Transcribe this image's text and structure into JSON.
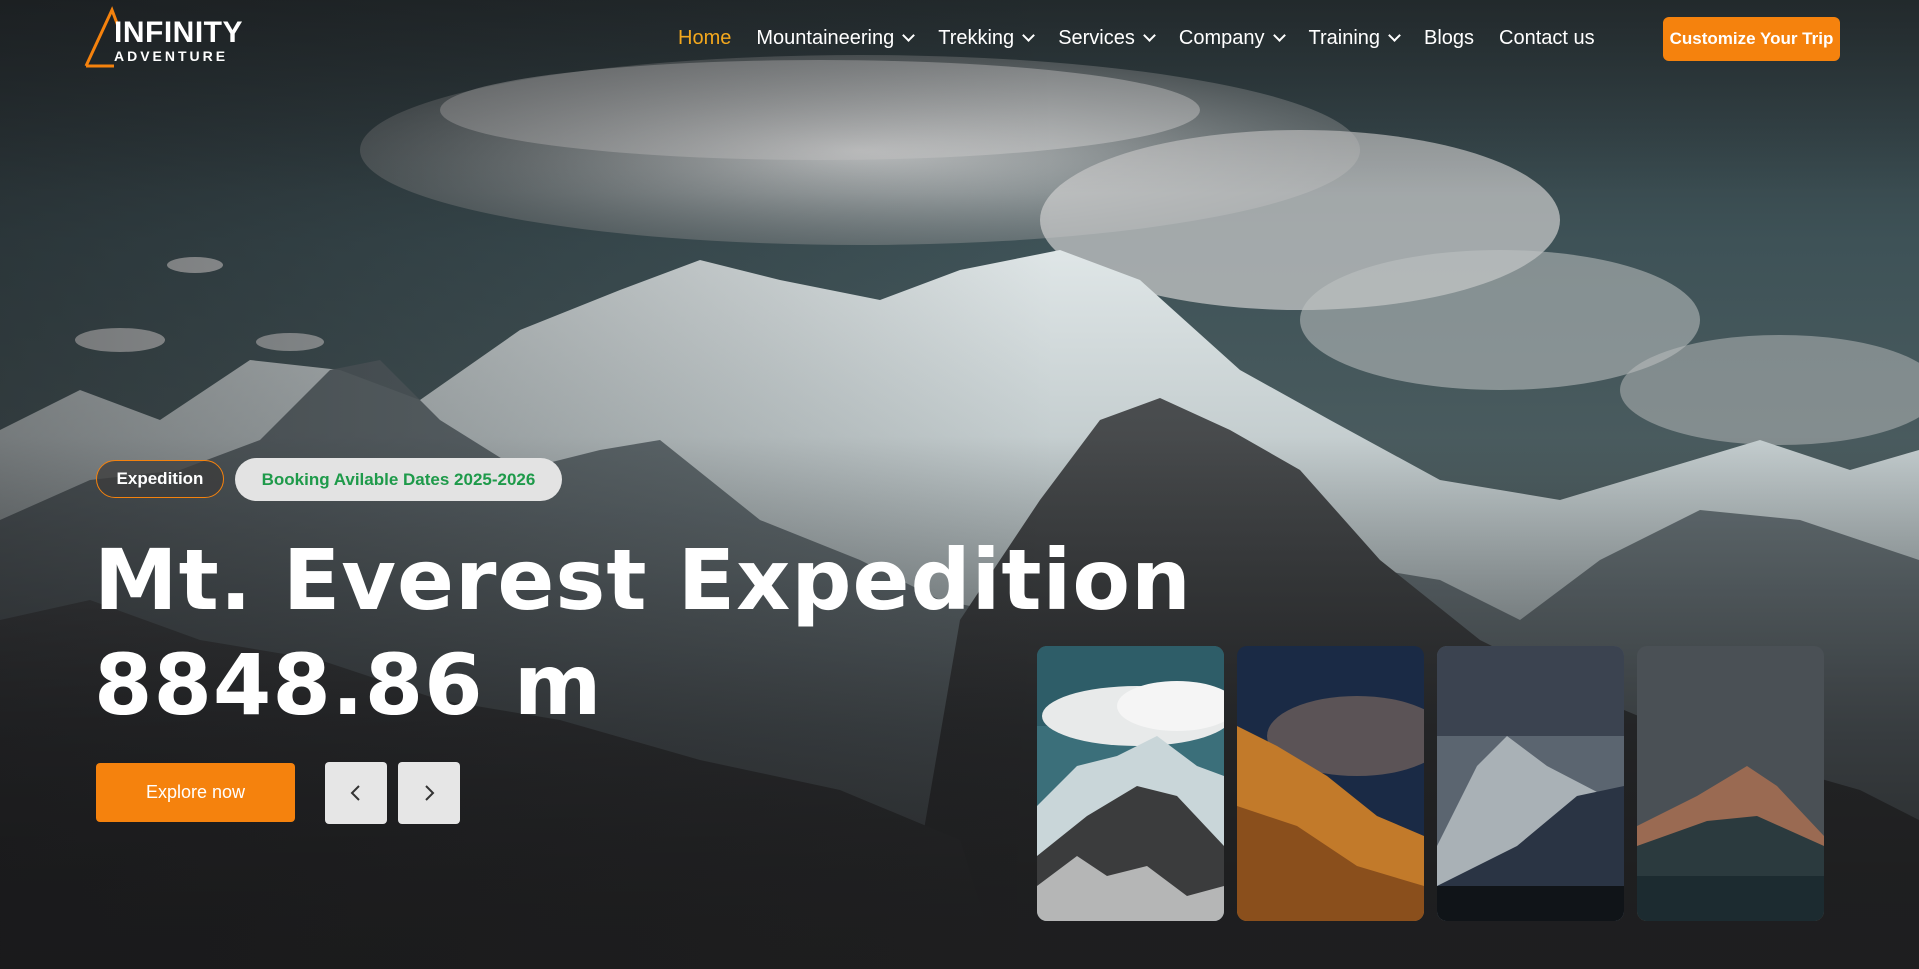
{
  "brand": {
    "name_line1": "INFINITY",
    "name_line2": "ADVENTURE",
    "accent_color": "#f5820d",
    "active_color": "#f4a81d"
  },
  "nav": {
    "items": [
      {
        "label": "Home",
        "active": true,
        "dropdown": false
      },
      {
        "label": "Mountaineering",
        "active": false,
        "dropdown": true
      },
      {
        "label": "Trekking",
        "active": false,
        "dropdown": true
      },
      {
        "label": "Services",
        "active": false,
        "dropdown": true
      },
      {
        "label": "Company",
        "active": false,
        "dropdown": true
      },
      {
        "label": "Training",
        "active": false,
        "dropdown": true
      },
      {
        "label": "Blogs",
        "active": false,
        "dropdown": false
      },
      {
        "label": "Contact us",
        "active": false,
        "dropdown": false
      }
    ],
    "cta_label": "Customize Your Trip"
  },
  "hero": {
    "badge_category": "Expedition",
    "badge_booking": "Booking Avilable Dates 2025-2026",
    "title_line1": "Mt. Everest Expedition",
    "title_line2": "8848.86 m",
    "explore_label": "Explore now",
    "prev_icon": "chevron-left-icon",
    "next_icon": "chevron-right-icon"
  },
  "thumbnails": [
    {
      "name": "thumbnail-everest-clouds"
    },
    {
      "name": "thumbnail-golden-ridge"
    },
    {
      "name": "thumbnail-misty-valley"
    },
    {
      "name": "thumbnail-sunset-peak"
    }
  ]
}
